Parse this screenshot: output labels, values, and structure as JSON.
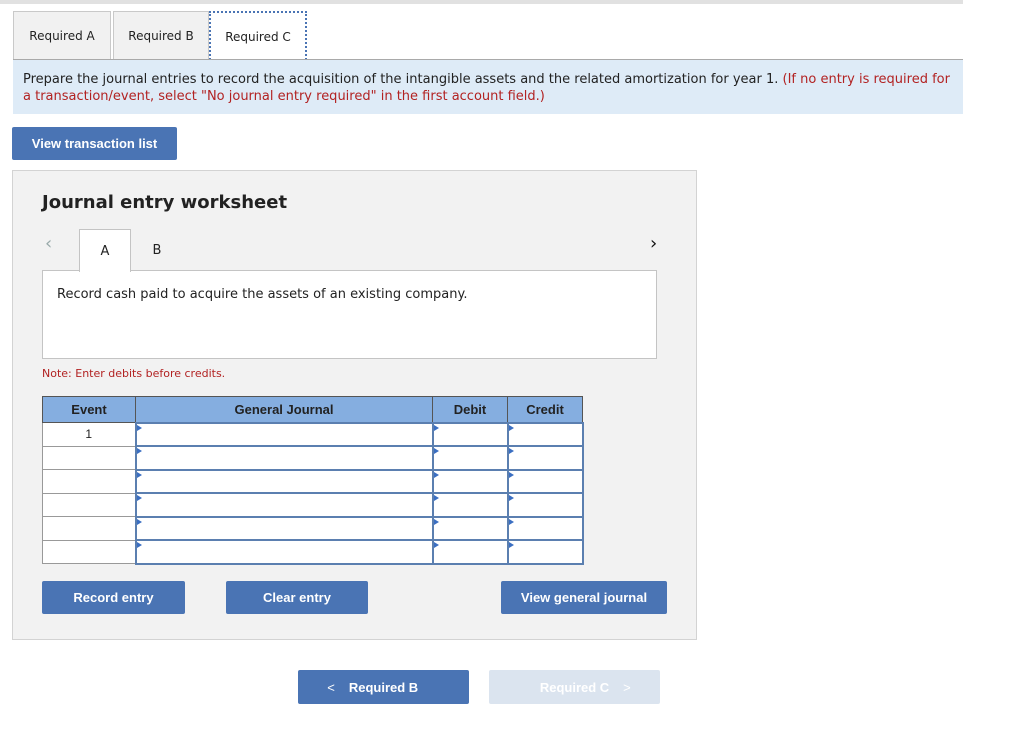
{
  "tabs": [
    {
      "label": "Required A",
      "active": false
    },
    {
      "label": "Required B",
      "active": false
    },
    {
      "label": "Required C",
      "active": true
    }
  ],
  "instructions": {
    "text": "Prepare the journal entries to record the acquisition of the intangible assets and the related amortization for year 1.",
    "hint": "(If no entry is required for a transaction/event, select \"No journal entry required\" in the first account field.)"
  },
  "buttons": {
    "view_transactions": "View transaction list",
    "record_entry": "Record entry",
    "clear_entry": "Clear entry",
    "view_general_journal": "View general journal"
  },
  "worksheet": {
    "title": "Journal entry worksheet",
    "prev_icon": "chevron-left-icon",
    "next_icon": "chevron-right-icon",
    "tabs": [
      {
        "label": "A",
        "active": true
      },
      {
        "label": "B",
        "active": false
      }
    ],
    "description": "Record cash paid to acquire the assets of an existing company.",
    "note": "Note: Enter debits before credits.",
    "table": {
      "headers": [
        "Event",
        "General Journal",
        "Debit",
        "Credit"
      ],
      "rows": [
        {
          "event": "1",
          "account": "",
          "debit": "",
          "credit": ""
        },
        {
          "event": "",
          "account": "",
          "debit": "",
          "credit": ""
        },
        {
          "event": "",
          "account": "",
          "debit": "",
          "credit": ""
        },
        {
          "event": "",
          "account": "",
          "debit": "",
          "credit": ""
        },
        {
          "event": "",
          "account": "",
          "debit": "",
          "credit": ""
        },
        {
          "event": "",
          "account": "",
          "debit": "",
          "credit": ""
        }
      ]
    }
  },
  "navigation": {
    "prev_label": "Required B",
    "prev_enabled": true,
    "next_label": "Required C",
    "next_enabled": false
  },
  "colors": {
    "accent": "#4a74b4",
    "hint_red": "#b22222",
    "instructions_bg": "#deebf7",
    "table_header_bg": "#85aee0"
  }
}
